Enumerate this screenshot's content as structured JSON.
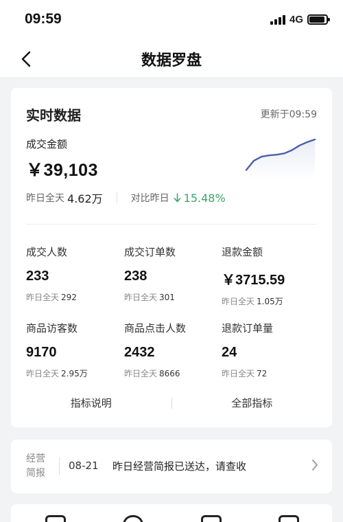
{
  "status_bar": {
    "time": "09:59",
    "network": "4G",
    "signal_bars": 4,
    "battery_level": 0.9
  },
  "nav": {
    "title": "数据罗盘",
    "back_icon": "chevron-left-icon"
  },
  "realtime": {
    "title": "实时数据",
    "update_time": "更新于09:59",
    "gmv_label": "成交金额",
    "gmv_value": "￥39,103",
    "yesterday_label": "昨日全天",
    "yesterday_value": "4.62万",
    "compare_label": "对比昨日",
    "compare_value": "15.48%",
    "compare_direction": "down",
    "compare_color": "#3aa569",
    "sparkline_color": "#4a5fa8",
    "sparkline_points": [
      14,
      28,
      34,
      36,
      37,
      39,
      44,
      51,
      56,
      60
    ]
  },
  "metrics": [
    {
      "label": "成交人数",
      "value": "233",
      "sub_label": "昨日全天",
      "sub_value": "292"
    },
    {
      "label": "成交订单数",
      "value": "238",
      "sub_label": "昨日全天",
      "sub_value": "301"
    },
    {
      "label": "退款金额",
      "value": "￥3715.59",
      "sub_label": "昨日全天",
      "sub_value": "1.05万"
    },
    {
      "label": "商品访客数",
      "value": "9170",
      "sub_label": "昨日全天",
      "sub_value": "2.95万"
    },
    {
      "label": "商品点击人数",
      "value": "2432",
      "sub_label": "昨日全天",
      "sub_value": "8666"
    },
    {
      "label": "退款订单量",
      "value": "24",
      "sub_label": "昨日全天",
      "sub_value": "72"
    }
  ],
  "links": {
    "explain": "指标说明",
    "all": "全部指标"
  },
  "report": {
    "tag_line1": "经营",
    "tag_line2": "简报",
    "date": "08-21",
    "text": "昨日经营简报已送达，请查收"
  }
}
